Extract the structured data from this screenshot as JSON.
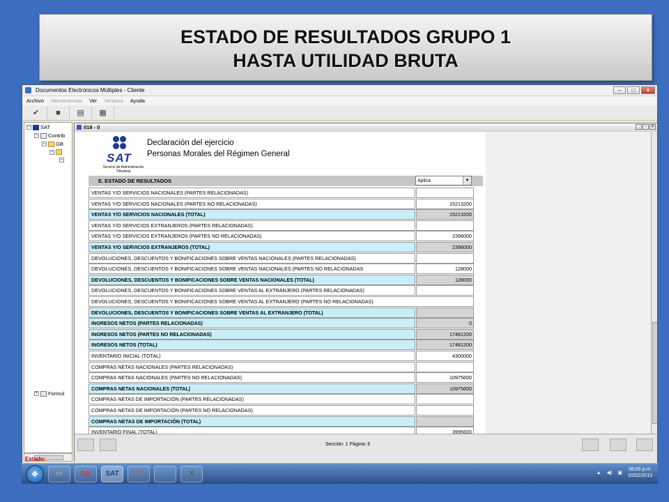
{
  "banner": {
    "line1": "ESTADO DE RESULTADOS GRUPO 1",
    "line2": "HASTA UTILIDAD BRUTA"
  },
  "app": {
    "title": "Documentos Electrónicos Múltiples - Cliente",
    "menu": [
      "Archivo",
      "Herramientas",
      "Ver",
      "Ventana",
      "Ayuda"
    ]
  },
  "tree": {
    "items": [
      "SAT",
      "Contrib",
      "GB",
      "",
      "",
      "Formul"
    ]
  },
  "doc": {
    "window_title": "018 - 0",
    "logo_text": "SAT",
    "logo_sub": "Servicio de Administración Tributaria",
    "title1": "Declaración del ejercicio",
    "title2": "Personas Morales del Régimen General",
    "section": "E. ESTADO DE RESULTADOS",
    "select_value": "Aplica",
    "rows": [
      {
        "label": "VENTAS Y/O SERVICIOS NACIONALES (PARTES RELACIONADAS)",
        "value": "",
        "total": false
      },
      {
        "label": "VENTAS Y/O SERVICIOS NACIONALES (PARTES NO RELACIONADAS)",
        "value": "15213200",
        "total": false
      },
      {
        "label": "VENTAS Y/O SERVICIOS NACIONALES (TOTAL)",
        "value": "15213200",
        "total": true
      },
      {
        "label": "VENTAS Y/O SERVICIOS EXTRANJEROS (PARTES RELACIONADAS)",
        "value": "",
        "total": false
      },
      {
        "label": "VENTAS Y/O SERVICIOS EXTRANJEROS (PARTES NO RELACIONADAS)",
        "value": "2396000",
        "total": false
      },
      {
        "label": "VENTAS Y/O SERVICIOS EXTRANJEROS (TOTAL)",
        "value": "2396000",
        "total": true
      },
      {
        "label": "DEVOLUCIONES, DESCUENTOS Y BONIFICACIONES SOBRE VENTAS NACIONALES (PARTES RELACIONADAS)",
        "value": "",
        "total": false
      },
      {
        "label": "DEVOLUCIONES, DESCUENTOS Y BONIFICACIONES SOBRE VENTAS NACIONALES (PARTES NO RELACIONADAS",
        "value": "128000",
        "total": false
      },
      {
        "label": "DEVOLUCIONES, DESCUENTOS Y BONIFICACIONES SOBRE VENTAS NACIONALES (TOTAL)",
        "value": "128000",
        "total": true
      },
      {
        "label": "DEVOLUCIONES, DESCUENTOS Y BONIFICACIONES SOBRE VENTAS AL EXTRANJERO (PARTES RELACIONADAS)",
        "value": "",
        "total": false
      },
      {
        "label": "DEVOLUCIONES, DESCUENTOS Y BONIFICACIONES SOBRE VENTAS AL EXTRANJERO (PARTES NO RELACIONADAS)",
        "value": "",
        "total": false,
        "wide": true
      },
      {
        "label": "DEVOLUCIONES, DESCUENTOS Y BONIFICACIONES SOBRE VENTAS AL EXTRANJERO (TOTAL)",
        "value": "",
        "total": true
      },
      {
        "label": "INGRESOS NETOS (PARTES RELACIONADAS)",
        "value": "0",
        "total": true
      },
      {
        "label": "INGRESOS NETOS (PARTES NO RELACIONADAS)",
        "value": "17481200",
        "total": true
      },
      {
        "label": "INGRESOS NETOS (TOTAL)",
        "value": "17481200",
        "total": true
      },
      {
        "label": "INVENTARIO INICIAL (TOTAL)",
        "value": "4300000",
        "total": false
      },
      {
        "label": "COMPRAS NETAS NACIONALES (PARTES RELACIONADAS)",
        "value": "",
        "total": false
      },
      {
        "label": "COMPRAS NETAS NACIONALES (PARTES NO RELACIONADAS)",
        "value": "10975600",
        "total": false
      },
      {
        "label": "COMPRAS NETAS NACIONALES (TOTAL)",
        "value": "10975600",
        "total": true
      },
      {
        "label": "COMPRAS NETAS DE IMPORTACIÓN (PARTES RELACIONADAS)",
        "value": "",
        "total": false
      },
      {
        "label": "COMPRAS NETAS DE IMPORTACIÓN (PARTES NO RELACIONADAS)",
        "value": "",
        "total": false
      },
      {
        "label": "COMPRAS NETAS DE IMPORTACIÓN (TOTAL)",
        "value": "",
        "total": true
      },
      {
        "label": "INVENTARIO FINAL (TOTAL)",
        "value": "3995600",
        "total": false
      }
    ],
    "status": "Sección: 1  Página: 6"
  },
  "estado_label": "Estado:",
  "clock": {
    "time": "08:05 p.m.",
    "date": "10/02/2013"
  },
  "taskbar_apps": [
    "",
    "SA",
    "SAT",
    "P",
    "e",
    "X"
  ]
}
